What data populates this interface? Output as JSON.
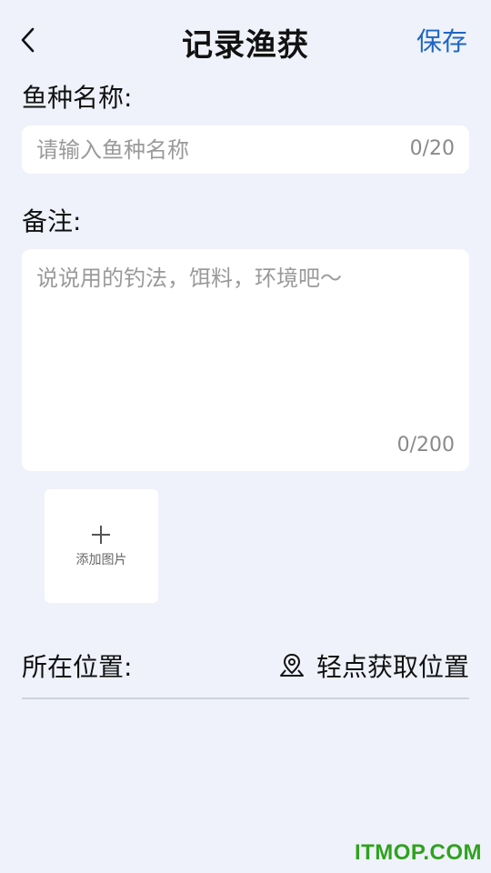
{
  "header": {
    "title": "记录渔获",
    "save_label": "保存",
    "back_icon": "chevron-left-icon"
  },
  "fish_name": {
    "label": "鱼种名称:",
    "placeholder": "请输入鱼种名称",
    "value": "",
    "counter": "0/20"
  },
  "note": {
    "label": "备注:",
    "placeholder": "说说用的钓法，饵料，环境吧～",
    "value": "",
    "counter": "0/200"
  },
  "photo": {
    "add_label": "添加图片",
    "icon": "plus-icon"
  },
  "location": {
    "label": "所在位置:",
    "action_label": "轻点获取位置",
    "icon": "map-pin-icon"
  },
  "watermark": "ITMOP.COM",
  "colors": {
    "background": "#eff2fa",
    "accent": "#1f66c2",
    "watermark": "#2fa21f"
  }
}
